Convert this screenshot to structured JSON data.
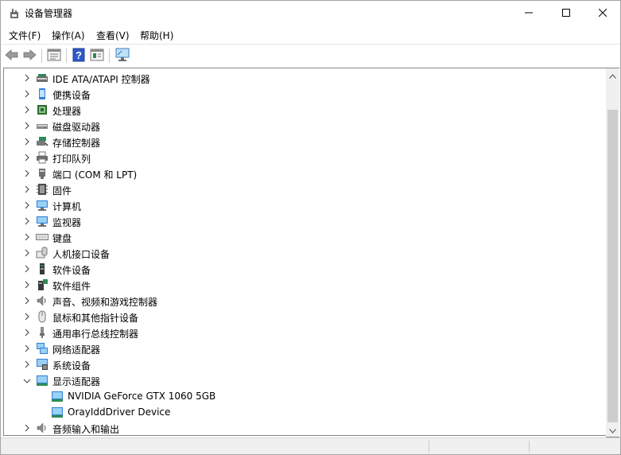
{
  "window": {
    "title": "设备管理器",
    "minimize_icon": "minimize-icon",
    "maximize_icon": "maximize-icon",
    "close_icon": "close-icon"
  },
  "menu": {
    "file": "文件(F)",
    "action": "操作(A)",
    "view": "查看(V)",
    "help": "帮助(H)"
  },
  "toolbar": {
    "icons": [
      "back-arrow-icon",
      "forward-arrow-icon",
      "properties-icon",
      "help-icon",
      "details-icon",
      "scan-monitor-icon"
    ]
  },
  "tree": {
    "categories": [
      {
        "label": "IDE ATA/ATAPI 控制器",
        "icon": "ide-controller-icon",
        "expanded": false
      },
      {
        "label": "便携设备",
        "icon": "portable-device-icon",
        "expanded": false
      },
      {
        "label": "处理器",
        "icon": "processor-icon",
        "expanded": false
      },
      {
        "label": "磁盘驱动器",
        "icon": "disk-drive-icon",
        "expanded": false
      },
      {
        "label": "存储控制器",
        "icon": "storage-controller-icon",
        "expanded": false
      },
      {
        "label": "打印队列",
        "icon": "printer-icon",
        "expanded": false
      },
      {
        "label": "端口 (COM 和 LPT)",
        "icon": "port-icon",
        "expanded": false
      },
      {
        "label": "固件",
        "icon": "firmware-icon",
        "expanded": false
      },
      {
        "label": "计算机",
        "icon": "computer-icon",
        "expanded": false
      },
      {
        "label": "监视器",
        "icon": "monitor-icon",
        "expanded": false
      },
      {
        "label": "键盘",
        "icon": "keyboard-icon",
        "expanded": false
      },
      {
        "label": "人机接口设备",
        "icon": "hid-icon",
        "expanded": false
      },
      {
        "label": "软件设备",
        "icon": "software-device-icon",
        "expanded": false
      },
      {
        "label": "软件组件",
        "icon": "software-component-icon",
        "expanded": false
      },
      {
        "label": "声音、视频和游戏控制器",
        "icon": "speaker-icon",
        "expanded": false
      },
      {
        "label": "鼠标和其他指针设备",
        "icon": "mouse-icon",
        "expanded": false
      },
      {
        "label": "通用串行总线控制器",
        "icon": "usb-icon",
        "expanded": false
      },
      {
        "label": "网络适配器",
        "icon": "network-adapter-icon",
        "expanded": false
      },
      {
        "label": "系统设备",
        "icon": "system-device-icon",
        "expanded": false
      },
      {
        "label": "显示适配器",
        "icon": "display-adapter-icon",
        "expanded": true,
        "children": [
          {
            "label": "NVIDIA GeForce GTX 1060 5GB",
            "icon": "display-adapter-icon"
          },
          {
            "label": "OrayIddDriver Device",
            "icon": "display-adapter-icon"
          }
        ]
      },
      {
        "label": "音频输入和输出",
        "icon": "audio-io-icon",
        "expanded": false
      }
    ]
  },
  "colors": {
    "accent_blue": "#2f7fd6",
    "scroll_track": "#f0f0f0",
    "scroll_thumb": "#cdcdcd"
  }
}
